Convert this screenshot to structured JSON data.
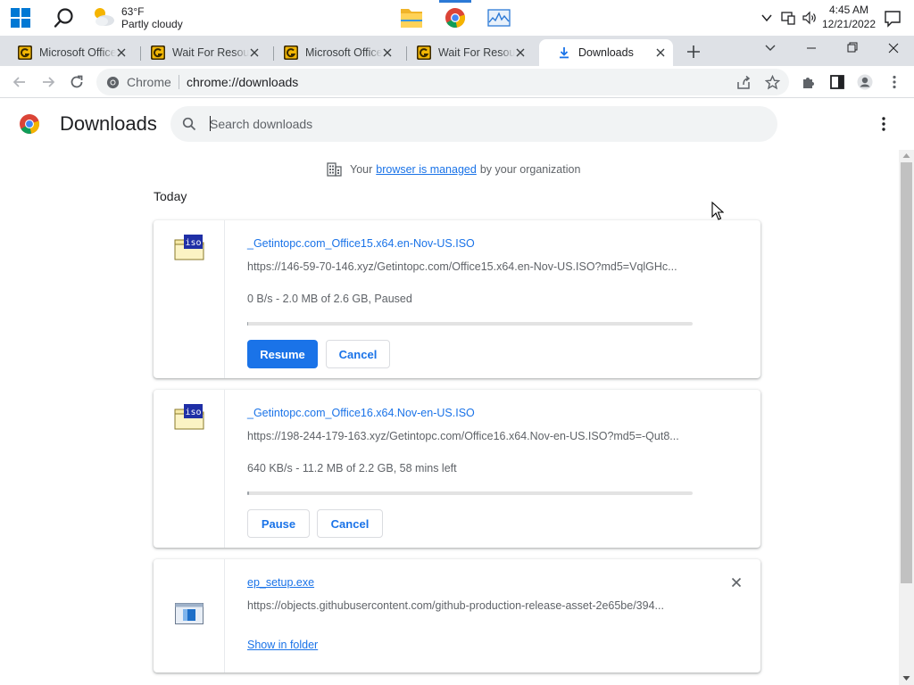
{
  "taskbar": {
    "weather": {
      "temperature": "63°F",
      "condition": "Partly cloudy"
    },
    "apps": [
      "file-explorer",
      "chrome",
      "task-manager"
    ],
    "clock": {
      "time": "4:45 AM",
      "date": "12/21/2022"
    }
  },
  "tabs": [
    {
      "title": "Microsoft Office",
      "favicon": "getintopc-favicon",
      "active": false
    },
    {
      "title": "Wait For Resource",
      "favicon": "getintopc-favicon",
      "active": false
    },
    {
      "title": "Microsoft Office",
      "favicon": "getintopc-favicon",
      "active": false
    },
    {
      "title": "Wait For Resource",
      "favicon": "getintopc-favicon",
      "active": false
    },
    {
      "title": "Downloads",
      "favicon": "download-icon",
      "active": true
    }
  ],
  "omnibox": {
    "scheme_label": "Chrome",
    "url": "chrome://downloads"
  },
  "page": {
    "title": "Downloads",
    "search_placeholder": "Search downloads",
    "managed_prefix": "Your",
    "managed_link": "browser is managed",
    "managed_suffix": "by your organization",
    "section_date": "Today"
  },
  "downloads": [
    {
      "file_name": "_Getintopc.com_Office15.x64.en-Nov-US.ISO",
      "url": "https://146-59-70-146.xyz/Getintopc.com/Office15.x64.en-Nov-US.ISO?md5=VqlGHc...",
      "status": "0 B/s - 2.0 MB of 2.6 GB, Paused",
      "progress_fraction": 0.0008,
      "primary_button": "Resume",
      "secondary_button": "Cancel",
      "icon": "iso-file-icon"
    },
    {
      "file_name": "_Getintopc.com_Office16.x64.Nov-en-US.ISO",
      "url": "https://198-244-179-163.xyz/Getintopc.com/Office16.x64.Nov-en-US.ISO?md5=-Qut8...",
      "status": "640 KB/s - 11.2 MB of 2.2 GB, 58 mins left",
      "progress_fraction": 0.005,
      "primary_button": "Pause",
      "secondary_button": "Cancel",
      "icon": "iso-file-icon"
    },
    {
      "file_name": "ep_setup.exe",
      "url": "https://objects.githubusercontent.com/github-production-release-asset-2e65be/394...",
      "action_link": "Show in folder",
      "icon": "exe-file-icon"
    }
  ],
  "colors": {
    "accent": "#1a73e8",
    "tabstrip": "#dee1e6",
    "omnibox": "#f1f3f4"
  }
}
